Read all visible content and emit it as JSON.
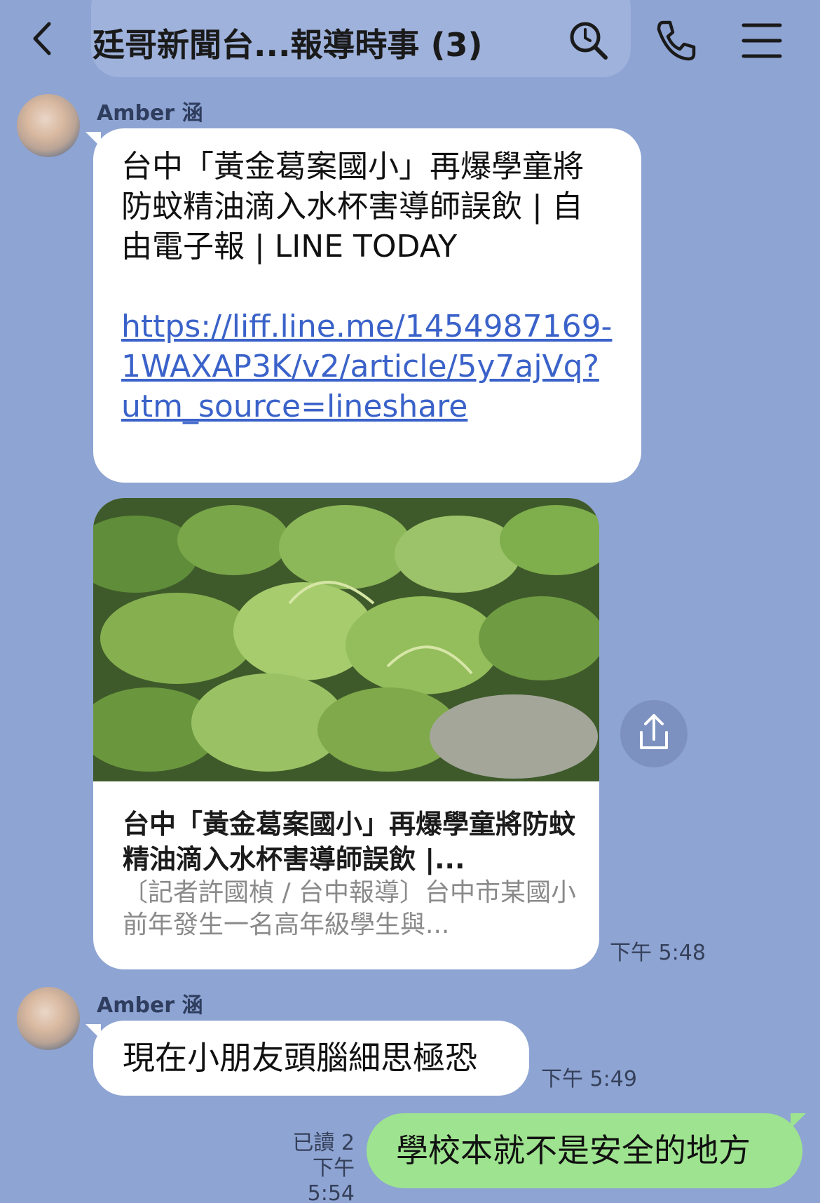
{
  "header": {
    "title": "廷哥新聞台...報導時事 (3)",
    "back_icon": "chevron-left-icon",
    "search_icon": "search-icon",
    "phone_icon": "phone-icon",
    "menu_icon": "menu-icon"
  },
  "messages": [
    {
      "sender": "Amber 涵",
      "text": "台中「黃金葛案國小」再爆學童將防蚊精油滴入水杯害導師誤飲 | 自由電子報 | LINE TODAY",
      "link": "https://liff.line.me/1454987169-1WAXAP3K/v2/article/5y7ajVq?utm_source=lineshare"
    },
    {
      "card_title": "台中「黃金葛案國小」再爆學童將防蚊精油滴入水杯害導師誤飲 |...",
      "card_desc": "〔記者許國楨 / 台中報導〕台中市某國小前年發生一名高年級學生與...",
      "time": "下午 5:48"
    },
    {
      "sender": "Amber 涵",
      "text": "現在小朋友頭腦細思極恐",
      "time": "下午 5:49"
    }
  ],
  "my_message": {
    "text": "學校本就不是安全的地方",
    "read": "已讀 2",
    "time": "下午 5:54"
  },
  "colors": {
    "background": "#8ea4d3",
    "my_bubble": "#9ee38f",
    "link": "#3a62c9"
  }
}
